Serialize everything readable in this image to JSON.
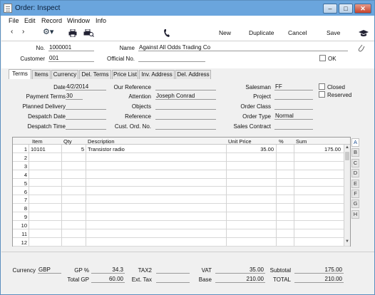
{
  "window": {
    "title": "Order: Inspect"
  },
  "menu": [
    "File",
    "Edit",
    "Record",
    "Window",
    "Info"
  ],
  "toolbar": {
    "new": "New",
    "duplicate": "Duplicate",
    "cancel": "Cancel",
    "save": "Save"
  },
  "header": {
    "no_label": "No.",
    "no_value": "1000001",
    "name_label": "Name",
    "name_value": "Against All Odds Trading Co",
    "customer_label": "Customer",
    "customer_value": "001",
    "official_label": "Official No.",
    "official_value": "",
    "ok_label": "OK"
  },
  "tabs": [
    "Terms",
    "Items",
    "Currency",
    "Del. Terms",
    "Price List",
    "Inv. Address",
    "Del. Address"
  ],
  "terms": {
    "date_label": "Date",
    "date_value": "4/2/2014",
    "payment_terms_label": "Payment Terms",
    "payment_terms_value": "30",
    "planned_delivery_label": "Planned Delivery",
    "planned_delivery_value": "",
    "despatch_date_label": "Despatch Date",
    "despatch_date_value": "",
    "despatch_time_label": "Despatch Time",
    "despatch_time_value": "",
    "our_reference_label": "Our Reference",
    "our_reference_value": "",
    "attention_label": "Attention",
    "attention_value": "Joseph Conrad",
    "objects_label": "Objects",
    "objects_value": "",
    "reference_label": "Reference",
    "reference_value": "",
    "cust_ord_label": "Cust. Ord. No.",
    "cust_ord_value": "",
    "salesman_label": "Salesman",
    "salesman_value": "FF",
    "project_label": "Project",
    "project_value": "",
    "order_class_label": "Order Class",
    "order_class_value": "",
    "order_type_label": "Order Type",
    "order_type_value": "Normal",
    "sales_contract_label": "Sales Contract",
    "sales_contract_value": "",
    "closed_label": "Closed",
    "reserved_label": "Reserved"
  },
  "grid": {
    "columns": [
      "Item",
      "Qty",
      "Description",
      "Unit Price",
      "%",
      "Sum"
    ],
    "rows": [
      {
        "n": "1",
        "item": "10101",
        "qty": "5",
        "desc": "Transistor radio",
        "price": "35.00",
        "pct": "",
        "sum": "175.00"
      },
      {
        "n": "2"
      },
      {
        "n": "3"
      },
      {
        "n": "4"
      },
      {
        "n": "5"
      },
      {
        "n": "6"
      },
      {
        "n": "7"
      },
      {
        "n": "8"
      },
      {
        "n": "9"
      },
      {
        "n": "10"
      },
      {
        "n": "11"
      },
      {
        "n": "12"
      }
    ],
    "side_tabs": [
      "A",
      "B",
      "C",
      "D",
      "E",
      "F",
      "G",
      "H"
    ]
  },
  "footer": {
    "currency_label": "Currency",
    "currency_value": "GBP",
    "gp_pct_label": "GP %",
    "gp_pct_value": "34.3",
    "total_gp_label": "Total GP",
    "total_gp_value": "60.00",
    "tax2_label": "TAX2",
    "tax2_value": "",
    "ext_tax_label": "Ext. Tax",
    "ext_tax_value": "",
    "vat_label": "VAT",
    "vat_value": "35.00",
    "base_label": "Base",
    "base_value": "210.00",
    "subtotal_label": "Subtotal",
    "subtotal_value": "175.00",
    "total_label": "TOTAL",
    "total_value": "210.00"
  }
}
